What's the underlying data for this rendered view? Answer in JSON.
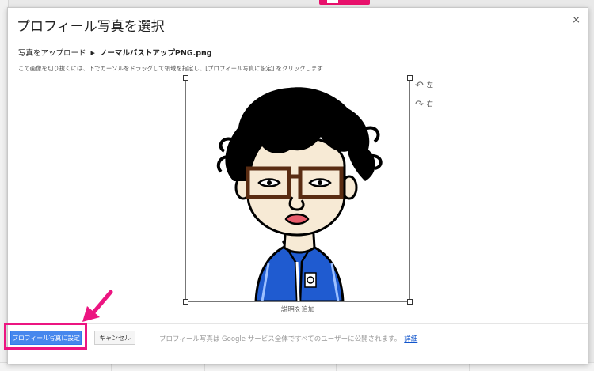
{
  "dialog": {
    "title": "プロフィール写真を選択",
    "close_glyph": "×",
    "breadcrumb": {
      "upload": "写真をアップロード",
      "separator": "▶",
      "file": "ノーマルバストアップPNG.png"
    },
    "instructions": "この画像を切り抜くには、下でカーソルをドラッグして領域を指定し、[プロフィール写真に設定] をクリックします",
    "rotate_left": {
      "icon": "rotate-left-icon",
      "glyph": "↶",
      "label": "左"
    },
    "rotate_right": {
      "icon": "rotate-right-icon",
      "glyph": "↷",
      "label": "右"
    },
    "caption_link": "説明を追加",
    "set_button": "プロフィール写真に設定",
    "cancel_button": "キャンセル",
    "public_note": "プロフィール写真は Google サービス全体ですべてのユーザーに公開されます。",
    "details_link": "詳細"
  },
  "colors": {
    "primary_button": "#4787ed",
    "highlight": "#ec1581",
    "jacket": "#1f5bd0",
    "link": "#1155cc"
  }
}
